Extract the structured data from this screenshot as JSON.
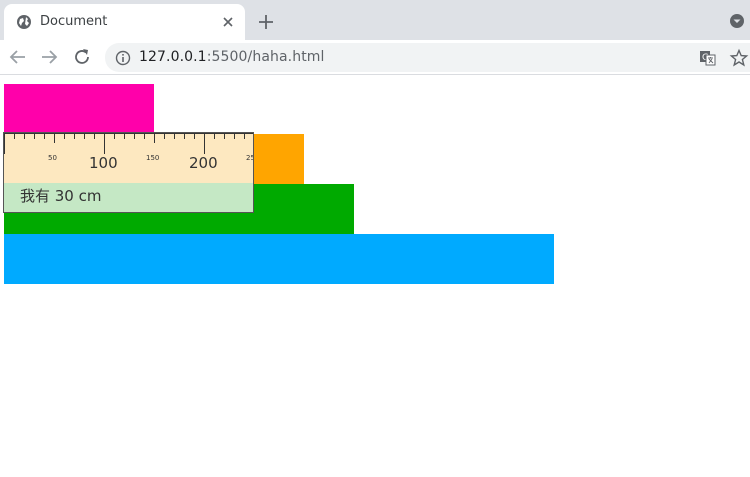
{
  "browser": {
    "tab": {
      "title": "Document"
    },
    "omnibox": {
      "host": "127.0.0.1",
      "path": ":5500/haha.html"
    }
  },
  "page": {
    "bars": [
      {
        "color": "#ff00aa"
      },
      {
        "color": "#ffa500"
      },
      {
        "color": "#00aa00"
      },
      {
        "color": "#00aaff"
      }
    ],
    "ruler": {
      "small_labels": [
        "50",
        "150",
        "25"
      ],
      "big_labels": [
        "100",
        "200"
      ],
      "caption": "我有 30 cm"
    }
  }
}
